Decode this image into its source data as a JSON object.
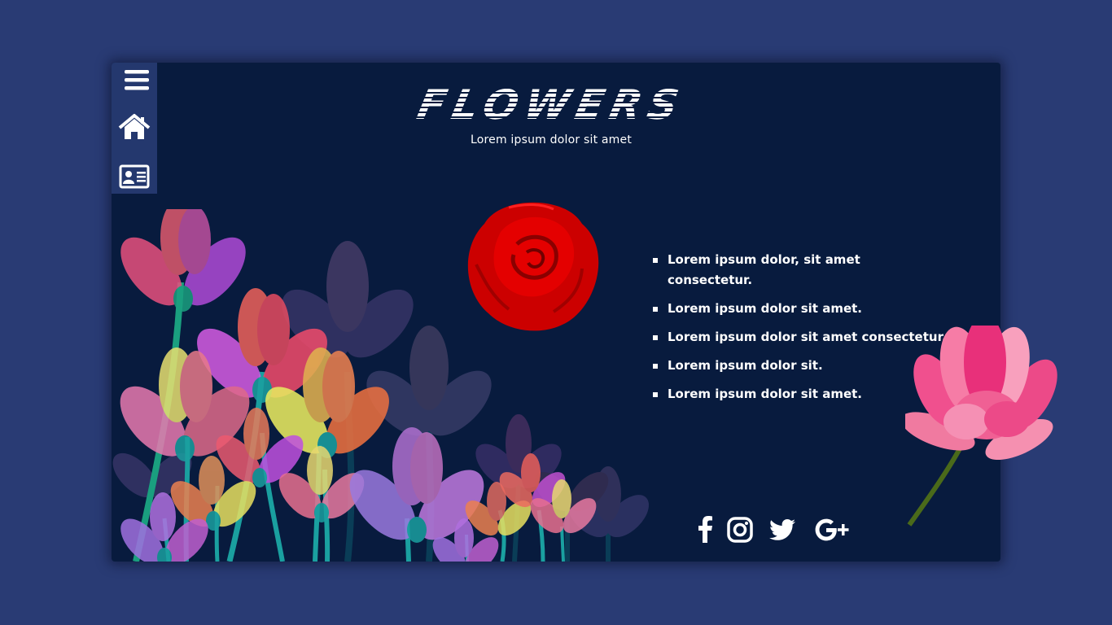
{
  "header": {
    "title": "FLOWERS",
    "subtitle": "Lorem ipsum dolor sit amet"
  },
  "sidebar": {
    "items": [
      {
        "icon": "menu-icon"
      },
      {
        "icon": "home-icon"
      },
      {
        "icon": "contact-card-icon"
      }
    ]
  },
  "content": {
    "list": [
      "Lorem ipsum dolor, sit amet consectetur.",
      "Lorem ipsum dolor sit amet.",
      "Lorem ipsum dolor sit amet consectetur.",
      "Lorem ipsum dolor sit.",
      "Lorem ipsum dolor sit amet."
    ]
  },
  "social": {
    "icons": [
      "facebook-icon",
      "instagram-icon",
      "twitter-icon",
      "google-plus-icon"
    ]
  },
  "colors": {
    "page_background": "#293b74",
    "card_background": "#081b3e",
    "sidebar_background": "#24386e",
    "text": "#ffffff",
    "rose": "#e00000",
    "lotus": "#f0508e"
  }
}
